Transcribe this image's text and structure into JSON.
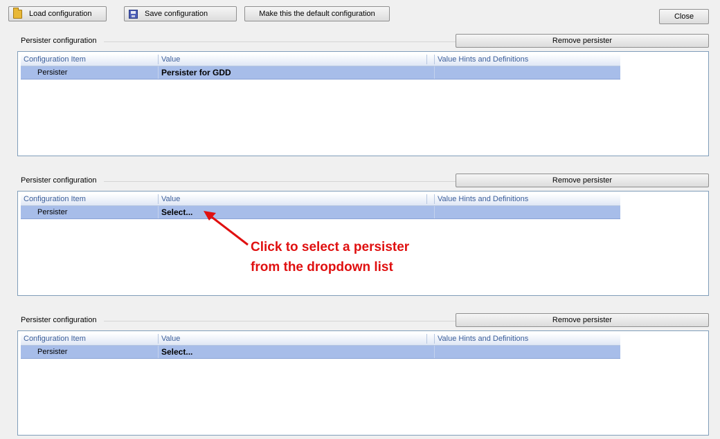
{
  "toolbar": {
    "load_label": "Load configuration",
    "save_label": "Save configuration",
    "default_label": "Make this the default configuration",
    "close_label": "Close"
  },
  "sections": [
    {
      "title": "Persister configuration",
      "remove_label": "Remove persister",
      "columns": [
        "Configuration Item",
        "Value",
        "Value Hints and Definitions"
      ],
      "row": {
        "item": "Persister",
        "value": "Persister for GDD"
      }
    },
    {
      "title": "Persister configuration",
      "remove_label": "Remove persister",
      "columns": [
        "Configuration Item",
        "Value",
        "Value Hints and Definitions"
      ],
      "row": {
        "item": "Persister",
        "value": "Select..."
      }
    },
    {
      "title": "Persister configuration",
      "remove_label": "Remove persister",
      "columns": [
        "Configuration Item",
        "Value",
        "Value Hints and Definitions"
      ],
      "row": {
        "item": "Persister",
        "value": "Select..."
      }
    }
  ],
  "annotation": {
    "line1": "Click to select a persister",
    "line2": "from the dropdown list",
    "color": "#e01010"
  },
  "colors": {
    "selected_row": "#a7bde9",
    "header_text": "#3b5e9a",
    "grid_border": "#7f9db9"
  }
}
